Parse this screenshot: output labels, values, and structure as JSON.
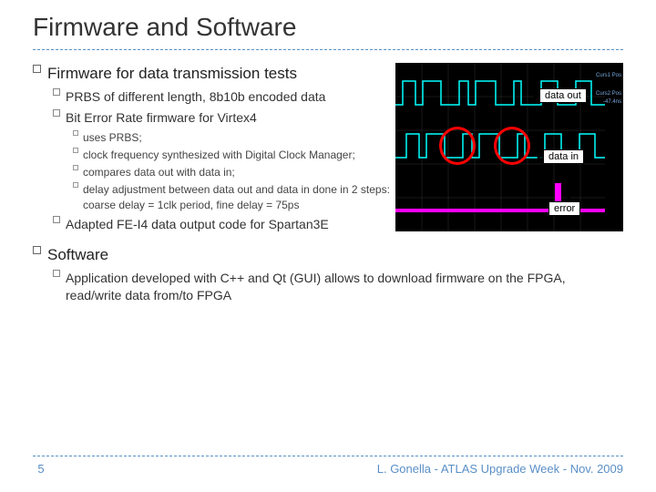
{
  "title": "Firmware and Software",
  "s1": {
    "heading": "Firmware for data transmission tests",
    "items": [
      {
        "text": "PRBS of different length, 8b10b encoded data"
      },
      {
        "text": "Bit Error Rate firmware for Virtex4",
        "sub": [
          "uses PRBS;",
          "clock frequency synthesized with Digital Clock Manager;",
          "compares data out with data in;",
          "delay adjustment between data out and data in done in 2 steps: coarse delay = 1clk period, fine delay = 75ps"
        ]
      },
      {
        "text": "Adapted FE-I4 data output code for Spartan3E"
      }
    ]
  },
  "s2": {
    "heading": "Software",
    "items": [
      {
        "text": "Application developed with C++ and Qt (GUI) allows to download firmware on the FPGA, read/write data from/to FPGA"
      }
    ]
  },
  "scope": {
    "label_out": "data out",
    "label_in": "data in",
    "label_err": "error",
    "side1": "Curs1 Pos",
    "side2": "Curs2 Pos",
    "side3": "-47.4ns"
  },
  "footer": {
    "page": "5",
    "text": "L. Gonella - ATLAS Upgrade Week - Nov. 2009"
  }
}
